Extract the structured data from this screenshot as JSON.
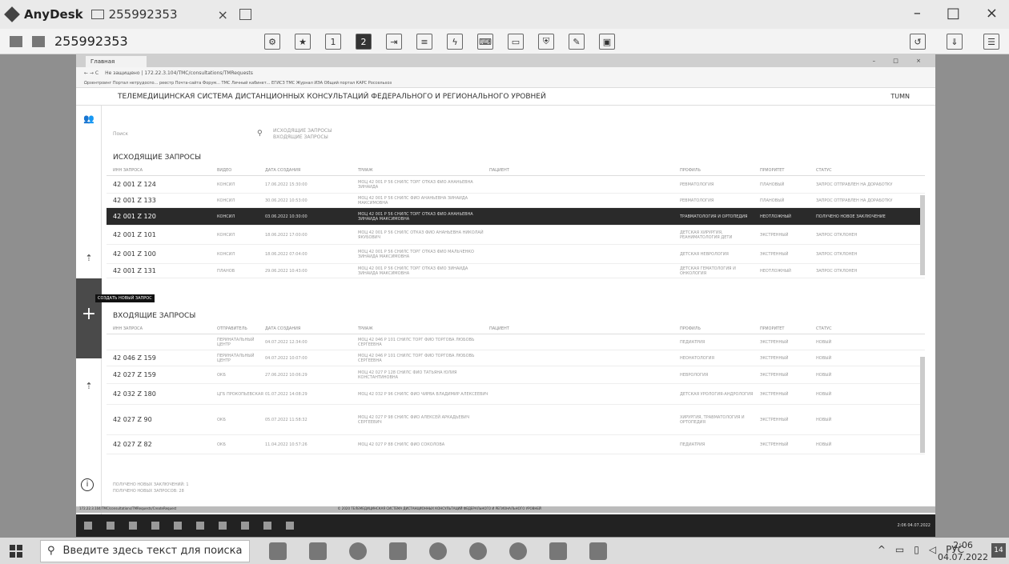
{
  "anydesk": {
    "app_name": "AnyDesk",
    "tab_label": "255992353",
    "close_tab": "×",
    "address": "255992353",
    "window_controls": [
      "–",
      "□",
      "×"
    ]
  },
  "browser": {
    "tab_title": "Главная",
    "address_url": "Не защищено | 172.22.3.104/TMC/consultations/TMRequests",
    "bookmarks": "Ωрзентроинг  Портал нетрудоспо...  реестр  Почта-сайта  Форум...  ТМС  Личный кабинет...  ЕГИСЗ  ТМС  Журнал ИЭА  Общий портал  КАРС Россельхоз"
  },
  "app": {
    "header_title": "ТЕЛЕМЕДИЦИНСКАЯ СИСТЕМА ДИСТАНЦИОННЫХ КОНСУЛЬТАЦИЙ ФЕДЕРАЛЬНОГО И РЕГИОНАЛЬНОГО УРОВНЕЙ",
    "user": "TUMN",
    "search_placeholder": "Поиск",
    "filters": [
      "ИСХОДЯЩИЕ ЗАПРОСЫ",
      "ВХОДЯЩИЕ ЗАПРОСЫ"
    ],
    "tooltip": "СОЗДАТЬ НОВЫЙ ЗАПРОС",
    "outgoing": {
      "title": "ИСХОДЯЩИЕ ЗАПРОСЫ",
      "columns": [
        "ИНН ЗАПРОСА",
        "ВИДЕО",
        "ДАТА СОЗДАНИЯ",
        "ТРИАЖ",
        "ПАЦИЕНТ",
        "ПРОФИЛЬ",
        "ПРИОРИТЕТ",
        "СТАТУС"
      ],
      "rows": [
        {
          "id": "42 001 Z 124",
          "c1": "КОНСИЛ",
          "c2": "17.06.2022 15:30:00",
          "c3": "МОЦ 42 001 Р 56 СНИЛС ТОРГ ОТКАЗ ФИО АНАНЬЕВНА ЗИНАИДА",
          "c5": "РЕВМАТОЛОГИЯ",
          "c6": "ПЛАНОВЫЙ",
          "c7": "ЗАПРОС ОТПРАВЛЕН НА ДОРАБОТКУ"
        },
        {
          "id": "42 001 Z 133",
          "c1": "КОНСИЛ",
          "c2": "30.06.2022 10:53:00",
          "c3": "МОЦ 42 001 Р 56 СНИЛС ФИО АНАНЬЕВНА ЗИНАИДА МАКСИМОВНА",
          "c5": "РЕВМАТОЛОГИЯ",
          "c6": "ПЛАНОВЫЙ",
          "c7": "ЗАПРОС ОТПРАВЛЕН НА ДОРАБОТКУ"
        },
        {
          "id": "42 001 Z 120",
          "c1": "КОНСИЛ",
          "c2": "03.06.2022 10:30:00",
          "c3": "МОЦ 42 001 Р 56 СНИЛС ТОРГ ОТКАЗ ФИО АНАНЬЕВНА ЗИНАИДА МАКСИМОВНА",
          "c5": "ТРАВМАТОЛОГИЯ И ОРТОПЕДИЯ",
          "c6": "НЕОТЛОЖНЫЙ",
          "c7": "ПОЛУЧЕНО НОВОЕ ЗАКЛЮЧЕНИЕ",
          "selected": true
        },
        {
          "id": "42 001 Z 101",
          "c1": "КОНСИЛ",
          "c2": "18.06.2022 17:00:00",
          "c3": "МОЦ 42 001 Р 56 СНИЛС ОТКАЗ ФИО АНАНЬЕВНА НИКОЛАЙ ЯКУБОВИЧ",
          "c5": "ДЕТСКАЯ ХИРУРГИЯ, РЕАНИМАТОЛОГИЯ ДЕТИ",
          "c6": "ЭКСТРЕННЫЙ",
          "c7": "ЗАПРОС ОТКЛОНЕН"
        },
        {
          "id": "42 001 Z 100",
          "c1": "КОНСИЛ",
          "c2": "18.06.2022 07:04:00",
          "c3": "МОЦ 42 001 Р 56 СНИЛС ТОРГ ОТКАЗ ФИО МАЛЬЧЕНКО ЗИНАИДА МАКСИМОВНА",
          "c5": "ДЕТСКАЯ НЕВРОЛОГИЯ",
          "c6": "ЭКСТРЕННЫЙ",
          "c7": "ЗАПРОС ОТКЛОНЕН"
        },
        {
          "id": "42 001 Z 131",
          "c1": "ПЛАНОВ",
          "c2": "29.06.2022 10:43:00",
          "c3": "МОЦ 42 001 Р 56 СНИЛС ТОРГ ОТКАЗ ФИО ЗИНАИДА ЗИНАИДА МАКСИМОВНА",
          "c5": "ДЕТСКАЯ ГЕМАТОЛОГИЯ И ОНКОЛОГИЯ",
          "c6": "НЕОТЛОЖНЫЙ",
          "c7": "ЗАПРОС ОТКЛОНЕН"
        }
      ]
    },
    "incoming": {
      "title": "ВХОДЯЩИЕ ЗАПРОСЫ",
      "columns": [
        "ИНН ЗАПРОСА",
        "ОТПРАВИТЕЛЬ",
        "ДАТА СОЗДАНИЯ",
        "ТРИАЖ",
        "ПАЦИЕНТ",
        "ПРОФИЛЬ",
        "ПРИОРИТЕТ",
        "СТАТУС"
      ],
      "rows": [
        {
          "id": "",
          "c1": "ПЕРИНАТАЛЬНЫЙ ЦЕНТР",
          "c2": "04.07.2022 12:34:00",
          "c3": "МОЦ 42 046 Р 101 СНИЛС ТОРГ ФИО ТОРГОВА ЛЮБОВЬ СЕРГЕЕВНА",
          "c5": "ПЕДИАТРИЯ",
          "c6": "ЭКСТРЕННЫЙ",
          "c7": "НОВЫЙ"
        },
        {
          "id": "42 046 Z 159",
          "c1": "ПЕРИНАТАЛЬНЫЙ ЦЕНТР",
          "c2": "04.07.2022 10:07:00",
          "c3": "МОЦ 42 046 Р 101 СНИЛС ТОРГ ФИО ТОРГОВА ЛЮБОВЬ СЕРГЕЕВНА",
          "c5": "НЕОНАТОЛОГИЯ",
          "c6": "ЭКСТРЕННЫЙ",
          "c7": "НОВЫЙ"
        },
        {
          "id": "42 027 Z 159",
          "c1": "ОКБ",
          "c2": "27.06.2022 10:06:29",
          "c3": "МОЦ 42 027 Р 128 СНИЛС ФИО ТАТЬЯНА ЮЛИЯ КОНСТАНТИНОВНА",
          "c5": "НЕВРОЛОГИЯ",
          "c6": "ЭКСТРЕННЫЙ",
          "c7": "НОВЫЙ"
        },
        {
          "id": "42 032 Z 180",
          "c1": "ЦГБ ПРОКОПЬЕВСКАЯ",
          "c2": "01.07.2022 14:08:29",
          "c3": "МОЦ 42 032 Р 96 СНИЛС ФИО ЧИРВА ВЛАДИМИР АЛЕКСЕЕВИЧ",
          "c5": "ДЕТСКАЯ УРОЛОГИЯ-АНДРОЛОГИЯ",
          "c6": "ЭКСТРЕННЫЙ",
          "c7": "НОВЫЙ"
        },
        {
          "id": "42 027 Z 90",
          "c1": "ОКБ",
          "c2": "05.07.2022 11:58:32",
          "c3": "МОЦ 42 027 Р 98 СНИЛС ФИО АЛЕКСЕЙ АРКАДЬЕВИЧ СЕРГЕЕВИЧ",
          "c5": "ХИРУРГИЯ, ТРАВМАТОЛОГИЯ И ОРТОПЕДИЯ",
          "c6": "ЭКСТРЕННЫЙ",
          "c7": "НОВЫЙ"
        },
        {
          "id": "42 027 Z 82",
          "c1": "ОКБ",
          "c2": "11.04.2022 10:57:26",
          "c3": "МОЦ 42 027 Р 88 СНИЛС ФИО СОКОЛОВА",
          "c5": "ПЕДИАТРИЯ",
          "c6": "ЭКСТРЕННЫЙ",
          "c7": "НОВЫЙ"
        }
      ]
    },
    "notes": [
      "ПОЛУЧЕНО НОВЫХ ЗАКЛЮЧЕНИЙ: 1",
      "ПОЛУЧЕНО НОВЫХ ЗАПРОСОВ: 28"
    ],
    "statusbar": "172.22.3.104/TMC/consultations/TMRequests/CreateRequest",
    "footer_center": "© 2020 ТЕЛЕМЕДИЦИНСКАЯ СИСТЕМА ДИСТАНЦИОННЫХ КОНСУЛЬТАЦИЙ ФЕДЕРАЛЬНОГО И РЕГИОНАЛЬНОГО УРОВНЕЙ",
    "remote_clock": "2:06 04.07.2022"
  },
  "taskbar": {
    "search_placeholder": "Введите здесь текст для поиска",
    "lang": "РУС",
    "time": "2:06",
    "date": "04.07.2022",
    "notifications": "14"
  }
}
